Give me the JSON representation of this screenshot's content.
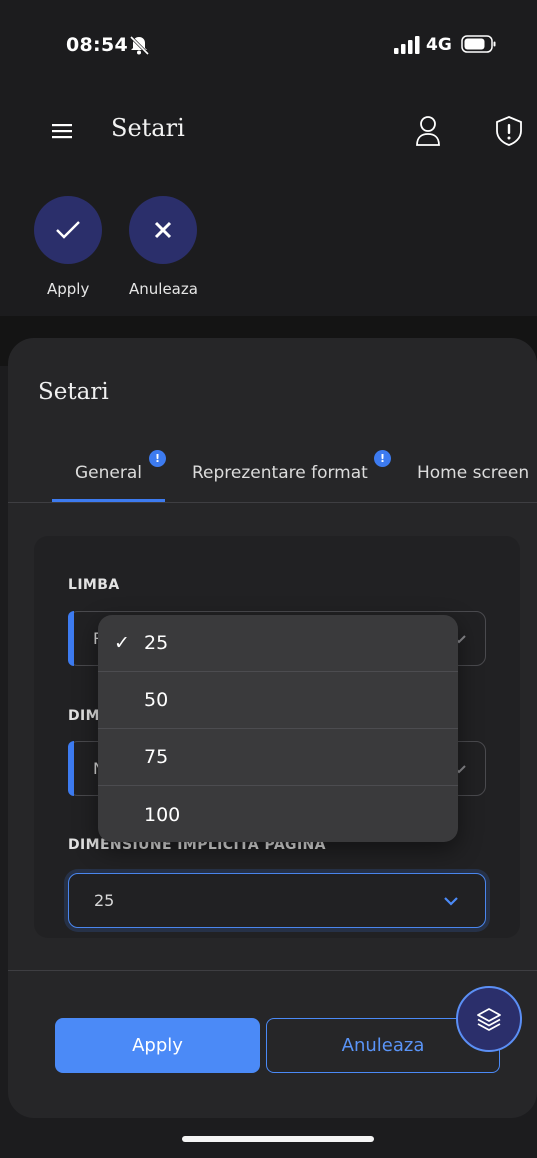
{
  "status_bar": {
    "time": "08:54",
    "network": "4G"
  },
  "header": {
    "title": "Setari"
  },
  "top_actions": {
    "apply_label": "Apply",
    "cancel_label": "Anuleaza"
  },
  "sheet": {
    "title": "Setari",
    "tabs": [
      {
        "label": "General",
        "badge": "!"
      },
      {
        "label": "Reprezentare format",
        "badge": "!"
      },
      {
        "label": "Home screen"
      }
    ]
  },
  "form": {
    "field1": {
      "label": "LIMBA",
      "value": "R"
    },
    "field2": {
      "label": "DIM",
      "value": "N"
    },
    "field3": {
      "label": "DIMENSIUNE IMPLICITA PAGINA",
      "value": "25"
    }
  },
  "dropdown": {
    "selected": "25",
    "check_glyph": "✓",
    "options": [
      "25",
      "50",
      "75",
      "100"
    ]
  },
  "footer": {
    "apply_label": "Apply",
    "cancel_label": "Anuleaza"
  },
  "colors": {
    "accent": "#3d7bf0",
    "circle_bg": "#2b2f6b",
    "sheet_bg": "#262628"
  }
}
